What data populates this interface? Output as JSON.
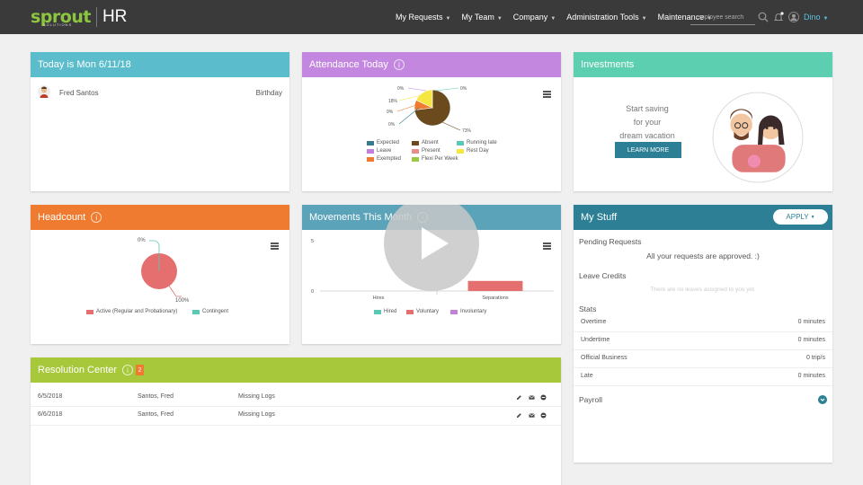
{
  "brand": {
    "logo_word": "sprout",
    "logo_sub": "SOLUTIONS",
    "product": "HR"
  },
  "nav": {
    "items": [
      {
        "label": "My Requests"
      },
      {
        "label": "My Team"
      },
      {
        "label": "Company"
      },
      {
        "label": "Administration Tools"
      },
      {
        "label": "Maintenance"
      }
    ],
    "search_placeholder": "employee search",
    "user": "Dino"
  },
  "today": {
    "title": "Today is Mon 6/11/18",
    "name": "Fred Santos",
    "event": "Birthday"
  },
  "attendance": {
    "title": "Attendance Today",
    "slice_labels": [
      "0%",
      "18%",
      "9%",
      "0%",
      "0%",
      "73%"
    ],
    "legend": [
      "Expected",
      "Absent",
      "Running late",
      "Leave",
      "Present",
      "Rest Day",
      "Exempted",
      "Flexi Per Week"
    ],
    "colors": {
      "expected": "#3a7a8c",
      "absent": "#6b4a1e",
      "running_late": "#5bc8b4",
      "leave": "#c081d9",
      "present": "#e88c8c",
      "rest_day": "#f5e642",
      "exempted": "#ee7b30",
      "flexi": "#9cc844"
    }
  },
  "investments": {
    "title": "Investments",
    "line1": "Start saving",
    "line2": "for your",
    "line3": "dream vacation",
    "button": "LEARN MORE"
  },
  "headcount": {
    "title": "Headcount",
    "label_top": "0%",
    "label_bottom": "100%",
    "legend": [
      "Active (Regular and Probationary)",
      "Contingent"
    ]
  },
  "movements": {
    "title": "Movements This Month",
    "y_ticks": [
      "5",
      "0"
    ],
    "categories": [
      "Hires",
      "Separations"
    ],
    "legend": [
      "Hired",
      "Voluntary",
      "Involuntary"
    ]
  },
  "mystuff": {
    "title": "My Stuff",
    "apply": "APPLY",
    "pending_title": "Pending Requests",
    "pending_text": "All your requests are approved. :)",
    "leave_title": "Leave Credits",
    "leave_text": "There are no leaves assigned to you yet.",
    "stats_title": "Stats",
    "stats": [
      {
        "label": "Overtime",
        "value": "0 minutes"
      },
      {
        "label": "Undertime",
        "value": "0 minutes"
      },
      {
        "label": "Official Business",
        "value": "0 trip/s"
      },
      {
        "label": "Late",
        "value": "0 minutes"
      }
    ],
    "payroll_title": "Payroll"
  },
  "resolution": {
    "title": "Resolution Center",
    "badge": "2",
    "rows": [
      {
        "date": "6/5/2018",
        "name": "Santos, Fred",
        "issue": "Missing Logs"
      },
      {
        "date": "6/6/2018",
        "name": "Santos, Fred",
        "issue": "Missing Logs"
      }
    ]
  },
  "chart_data": [
    {
      "type": "pie",
      "title": "Attendance Today",
      "categories": [
        "Expected",
        "Absent",
        "Running late",
        "Leave",
        "Present",
        "Rest Day",
        "Exempted",
        "Flexi Per Week"
      ],
      "values": [
        0,
        73,
        0,
        0,
        0,
        18,
        9,
        0
      ],
      "legend_position": "bottom"
    },
    {
      "type": "pie",
      "title": "Headcount",
      "categories": [
        "Active (Regular and Probationary)",
        "Contingent"
      ],
      "values": [
        100,
        0
      ],
      "legend_position": "bottom"
    },
    {
      "type": "bar",
      "title": "Movements This Month",
      "categories": [
        "Hires",
        "Separations"
      ],
      "series": [
        {
          "name": "Hired",
          "values": [
            0,
            0
          ]
        },
        {
          "name": "Voluntary",
          "values": [
            0,
            1
          ]
        },
        {
          "name": "Involuntary",
          "values": [
            0,
            0
          ]
        }
      ],
      "ylim": [
        0,
        5
      ],
      "legend_position": "bottom"
    }
  ]
}
